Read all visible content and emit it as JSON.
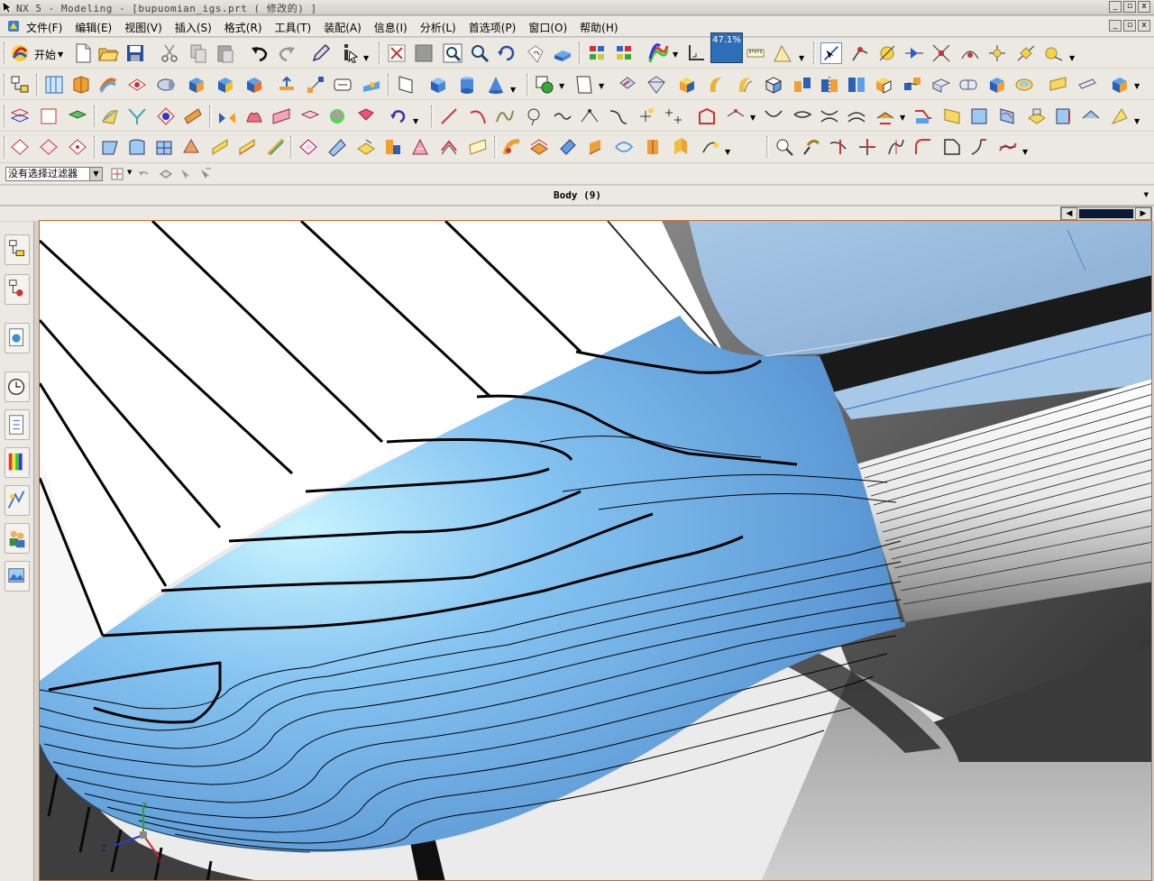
{
  "window": {
    "title": "NX 5 - Modeling - [bupuomian_igs.prt ( 修改的) ]",
    "buttons": [
      "_",
      "▫",
      "x"
    ]
  },
  "menu": {
    "items": [
      "文件(F)",
      "编辑(E)",
      "视图(V)",
      "插入(S)",
      "格式(R)",
      "工具(T)",
      "装配(A)",
      "信息(I)",
      "分析(L)",
      "首选项(P)",
      "窗口(O)",
      "帮助(H)"
    ]
  },
  "toolbar": {
    "start_label": "开始",
    "zoom_value": "47.1%"
  },
  "selection": {
    "filter_value": "没有选择过滤器"
  },
  "status": {
    "text": "Body (9)"
  },
  "triad": {
    "z_label": "Z",
    "x_label": "X",
    "y_label": "Y"
  },
  "colors": {
    "surface_blue": "#7fbfef",
    "surface_highlight": "#c8f4ff",
    "viewport_border": "#c46a28",
    "chrome": "#ece9e2"
  }
}
